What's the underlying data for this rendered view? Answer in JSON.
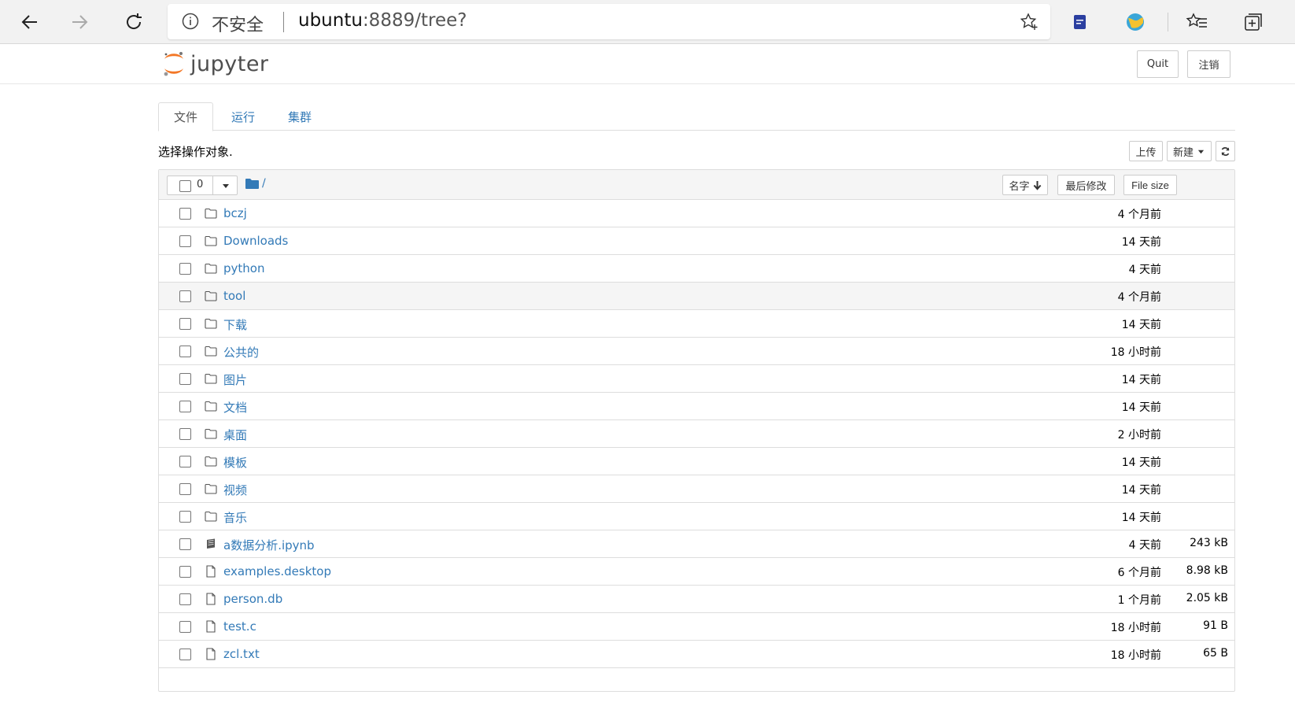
{
  "browser": {
    "insecure_label": "不安全",
    "url_host": "ubuntu",
    "url_rest": ":8889/tree?"
  },
  "header": {
    "logo_text": "jupyter",
    "quit_label": "Quit",
    "logout_label": "注销"
  },
  "tabs": [
    {
      "label": "文件"
    },
    {
      "label": "运行"
    },
    {
      "label": "集群"
    }
  ],
  "toolbar": {
    "hint": "选择操作对象.",
    "upload_label": "上传",
    "new_label": "新建",
    "selected_count": "0",
    "breadcrumb": "/"
  },
  "columns": {
    "name": "名字",
    "modified": "最后修改",
    "size": "File size"
  },
  "files": [
    {
      "name": "bczj",
      "type": "folder",
      "modified": "4 个月前",
      "size": ""
    },
    {
      "name": "Downloads",
      "type": "folder",
      "modified": "14 天前",
      "size": ""
    },
    {
      "name": "python",
      "type": "folder",
      "modified": "4 天前",
      "size": ""
    },
    {
      "name": "tool",
      "type": "folder",
      "modified": "4 个月前",
      "size": ""
    },
    {
      "name": "下载",
      "type": "folder",
      "modified": "14 天前",
      "size": ""
    },
    {
      "name": "公共的",
      "type": "folder",
      "modified": "18 小时前",
      "size": ""
    },
    {
      "name": "图片",
      "type": "folder",
      "modified": "14 天前",
      "size": ""
    },
    {
      "name": "文档",
      "type": "folder",
      "modified": "14 天前",
      "size": ""
    },
    {
      "name": "桌面",
      "type": "folder",
      "modified": "2 小时前",
      "size": ""
    },
    {
      "name": "模板",
      "type": "folder",
      "modified": "14 天前",
      "size": ""
    },
    {
      "name": "视频",
      "type": "folder",
      "modified": "14 天前",
      "size": ""
    },
    {
      "name": "音乐",
      "type": "folder",
      "modified": "14 天前",
      "size": ""
    },
    {
      "name": "a数据分析.ipynb",
      "type": "notebook",
      "modified": "4 天前",
      "size": "243 kB"
    },
    {
      "name": "examples.desktop",
      "type": "file",
      "modified": "6 个月前",
      "size": "8.98 kB"
    },
    {
      "name": "person.db",
      "type": "file",
      "modified": "1 个月前",
      "size": "2.05 kB"
    },
    {
      "name": "test.c",
      "type": "file",
      "modified": "18 小时前",
      "size": "91 B"
    },
    {
      "name": "zcl.txt",
      "type": "file",
      "modified": "18 小时前",
      "size": "65 B"
    }
  ],
  "colors": {
    "link": "#337ab7",
    "jupyter_orange": "#f37726"
  }
}
